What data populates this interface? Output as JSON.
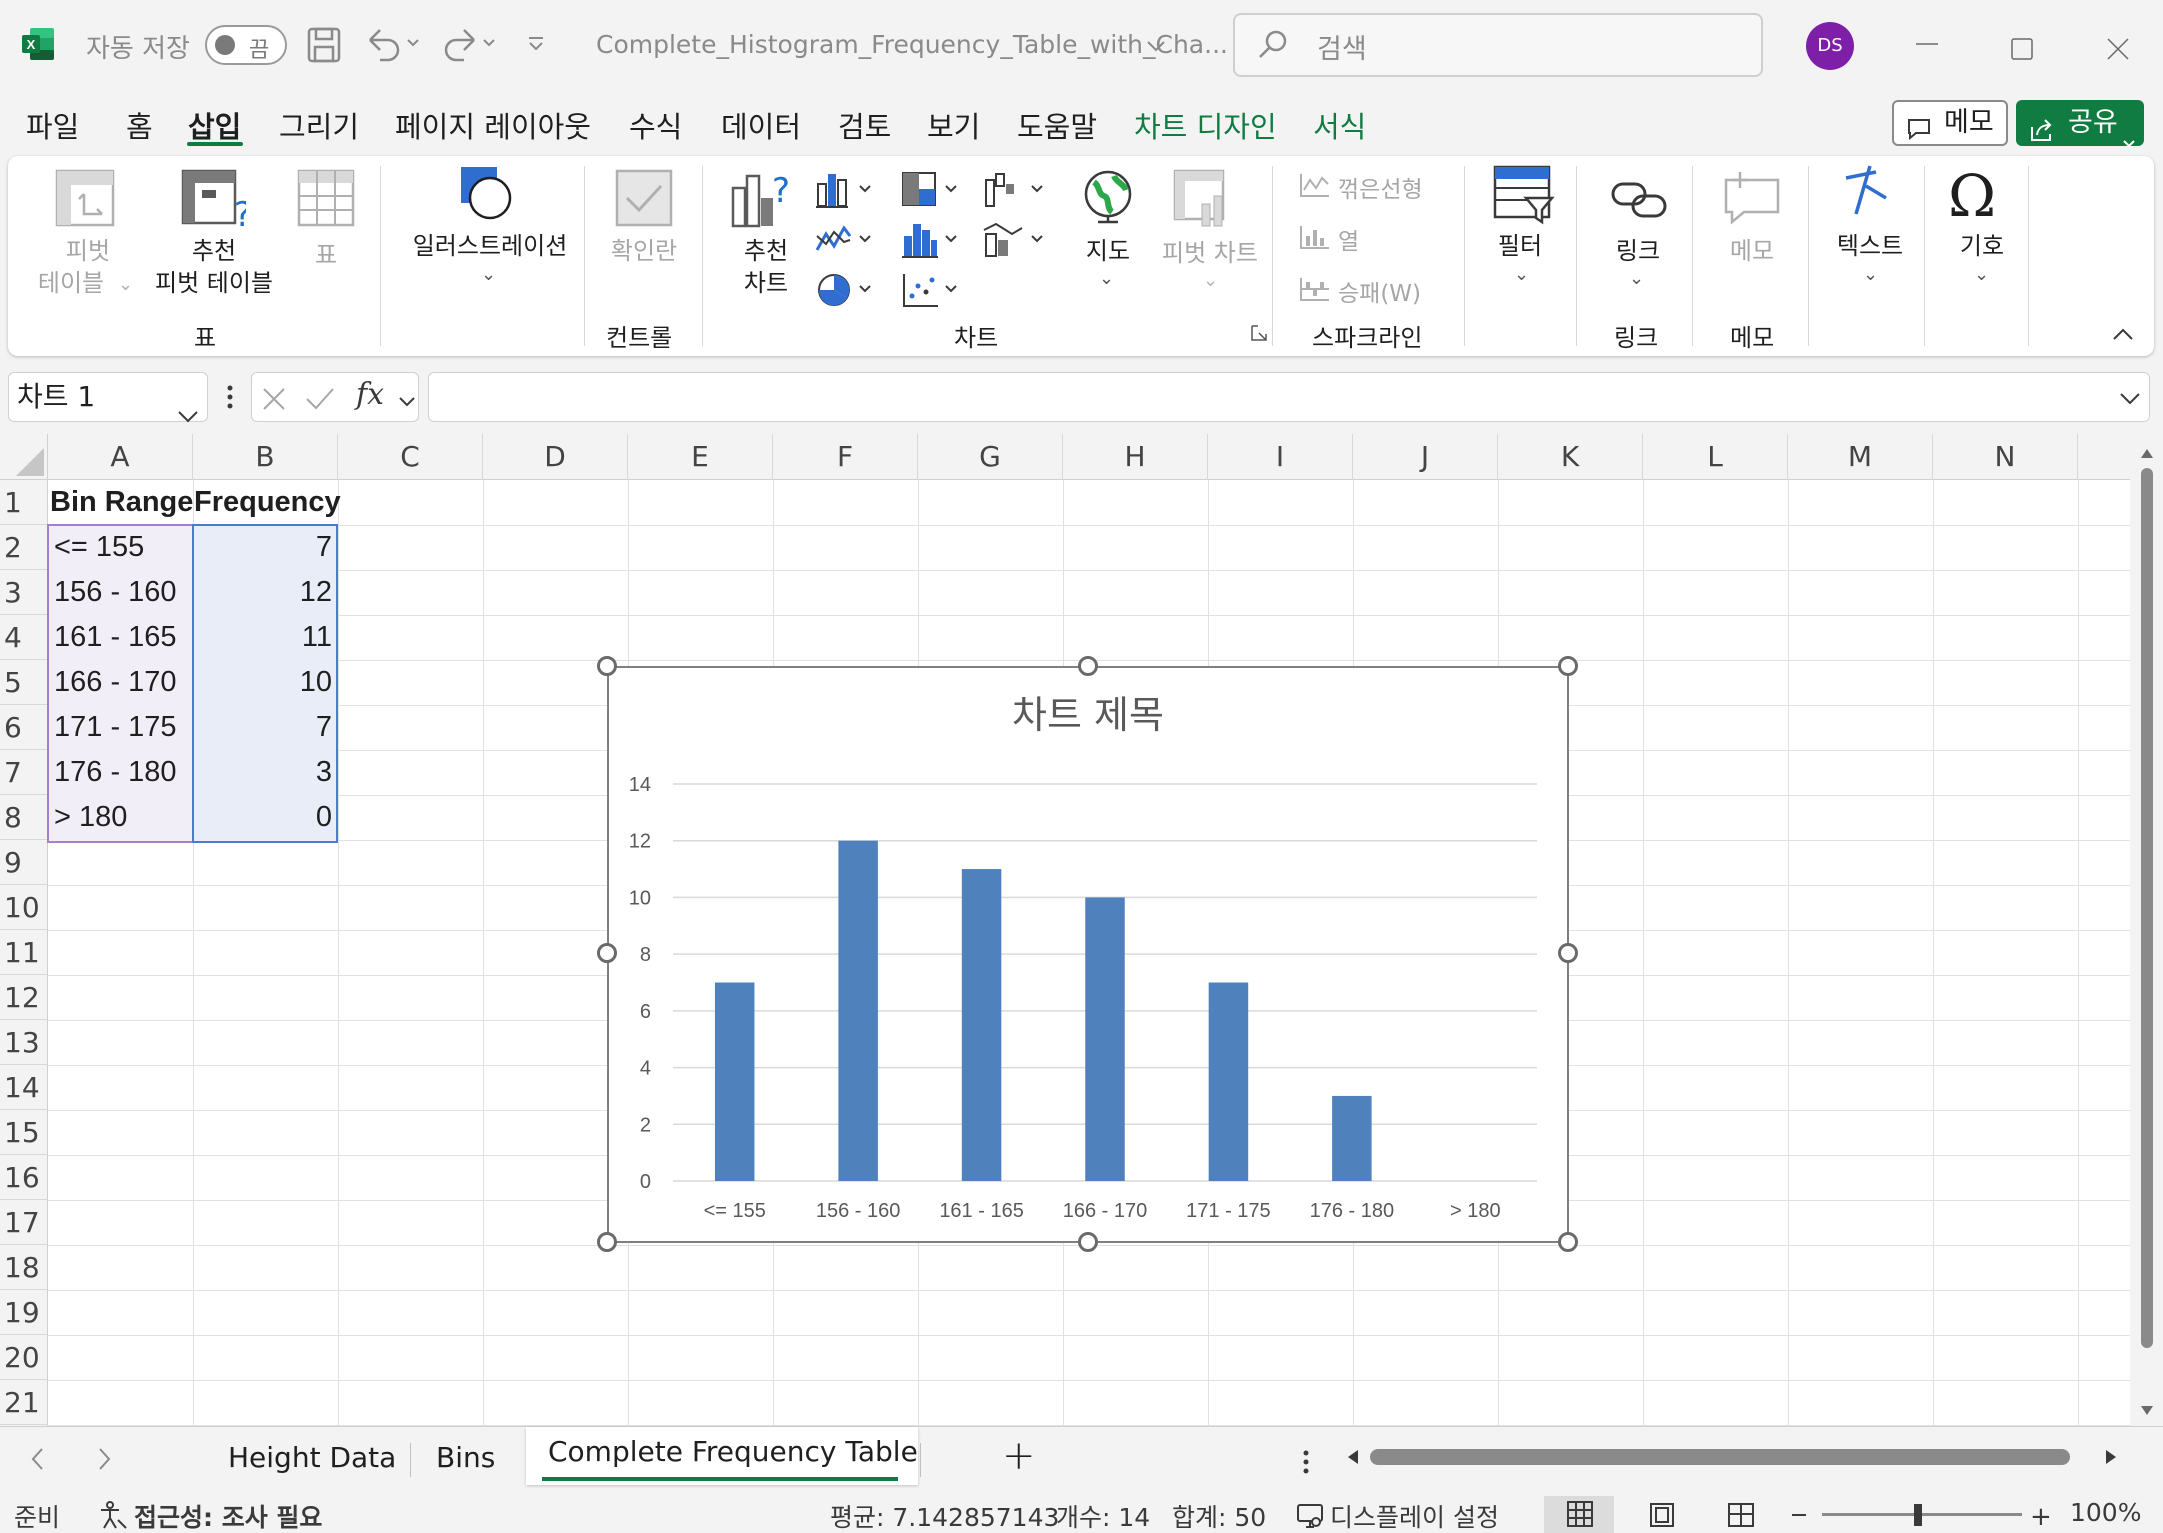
{
  "titlebar": {
    "autosave_label": "자동 저장",
    "autosave_state": "끔",
    "filename": "Complete_Histogram_Frequency_Table_with_Cha...",
    "search_placeholder": "검색",
    "user_initials": "DS"
  },
  "menu": {
    "tabs": [
      "파일",
      "홈",
      "삽입",
      "그리기",
      "페이지 레이아웃",
      "수식",
      "데이터",
      "검토",
      "보기",
      "도움말",
      "차트 디자인",
      "서식"
    ],
    "active_tab": "삽입",
    "memo_button": "메모",
    "share_button": "공유"
  },
  "ribbon": {
    "pivot_table": "피벗\n테이블",
    "pivot_table_1": "피벗",
    "pivot_table_2": "테이블",
    "recommended_pivot_1": "추천",
    "recommended_pivot_2": "피벗 테이블",
    "table": "표",
    "group_table": "표",
    "illustrations": "일러스트레이션",
    "checkbox": "확인란",
    "group_controls": "컨트롤",
    "recommended_charts_1": "추천",
    "recommended_charts_2": "차트",
    "map": "지도",
    "pivot_chart": "피벗 차트",
    "group_charts": "차트",
    "spark_line": "꺾은선형",
    "spark_column": "열",
    "spark_winloss": "승패(W)",
    "group_sparklines": "스파크라인",
    "filter": "필터",
    "link": "링크",
    "group_links": "링크",
    "memo": "메모",
    "group_memo": "메모",
    "text": "텍스트",
    "symbol": "기호"
  },
  "formula_bar": {
    "name_box": "차트 1",
    "fx": "fx",
    "formula": ""
  },
  "sheet": {
    "columns": [
      "A",
      "B",
      "C",
      "D",
      "E",
      "F",
      "G",
      "H",
      "I",
      "J",
      "K",
      "L",
      "M",
      "N"
    ],
    "rows": [
      "1",
      "2",
      "3",
      "4",
      "5",
      "6",
      "7",
      "8",
      "9",
      "10",
      "11",
      "12",
      "13",
      "14",
      "15",
      "16",
      "17",
      "18",
      "19",
      "20",
      "21"
    ],
    "headers": [
      "Bin Range",
      "Frequency"
    ],
    "data": [
      {
        "range": "<= 155",
        "freq": "7"
      },
      {
        "range": "156 - 160",
        "freq": "12"
      },
      {
        "range": "161 - 165",
        "freq": "11"
      },
      {
        "range": "166 - 170",
        "freq": "10"
      },
      {
        "range": "171 - 175",
        "freq": "7"
      },
      {
        "range": "176 - 180",
        "freq": "3"
      },
      {
        "range": "> 180",
        "freq": "0"
      }
    ]
  },
  "chart_data": {
    "type": "bar",
    "title": "차트 제목",
    "categories": [
      "<= 155",
      "156 - 160",
      "161 - 165",
      "166 - 170",
      "171 - 175",
      "176 - 180",
      "> 180"
    ],
    "values": [
      7,
      12,
      11,
      10,
      7,
      3,
      0
    ],
    "ylim": [
      0,
      14
    ],
    "yticks": [
      0,
      2,
      4,
      6,
      8,
      10,
      12,
      14
    ],
    "xlabel": "",
    "ylabel": "",
    "grid": true,
    "legend": "none",
    "bar_color": "#4f81bd"
  },
  "sheet_tabs": {
    "tabs": [
      "Height Data",
      "Bins",
      "Complete Frequency Table"
    ],
    "active": "Complete Frequency Table",
    "add": "+"
  },
  "status": {
    "ready": "준비",
    "accessibility": "접근성: 조사 필요",
    "average": "평균: 7.142857143",
    "count": "개수: 14",
    "sum": "합계: 50",
    "display_settings": "디스플레이 설정",
    "zoom": "100%"
  },
  "colors": {
    "excel_green": "#107c41",
    "bar": "#4f81bd",
    "selection_fill": "#e8edf8"
  }
}
